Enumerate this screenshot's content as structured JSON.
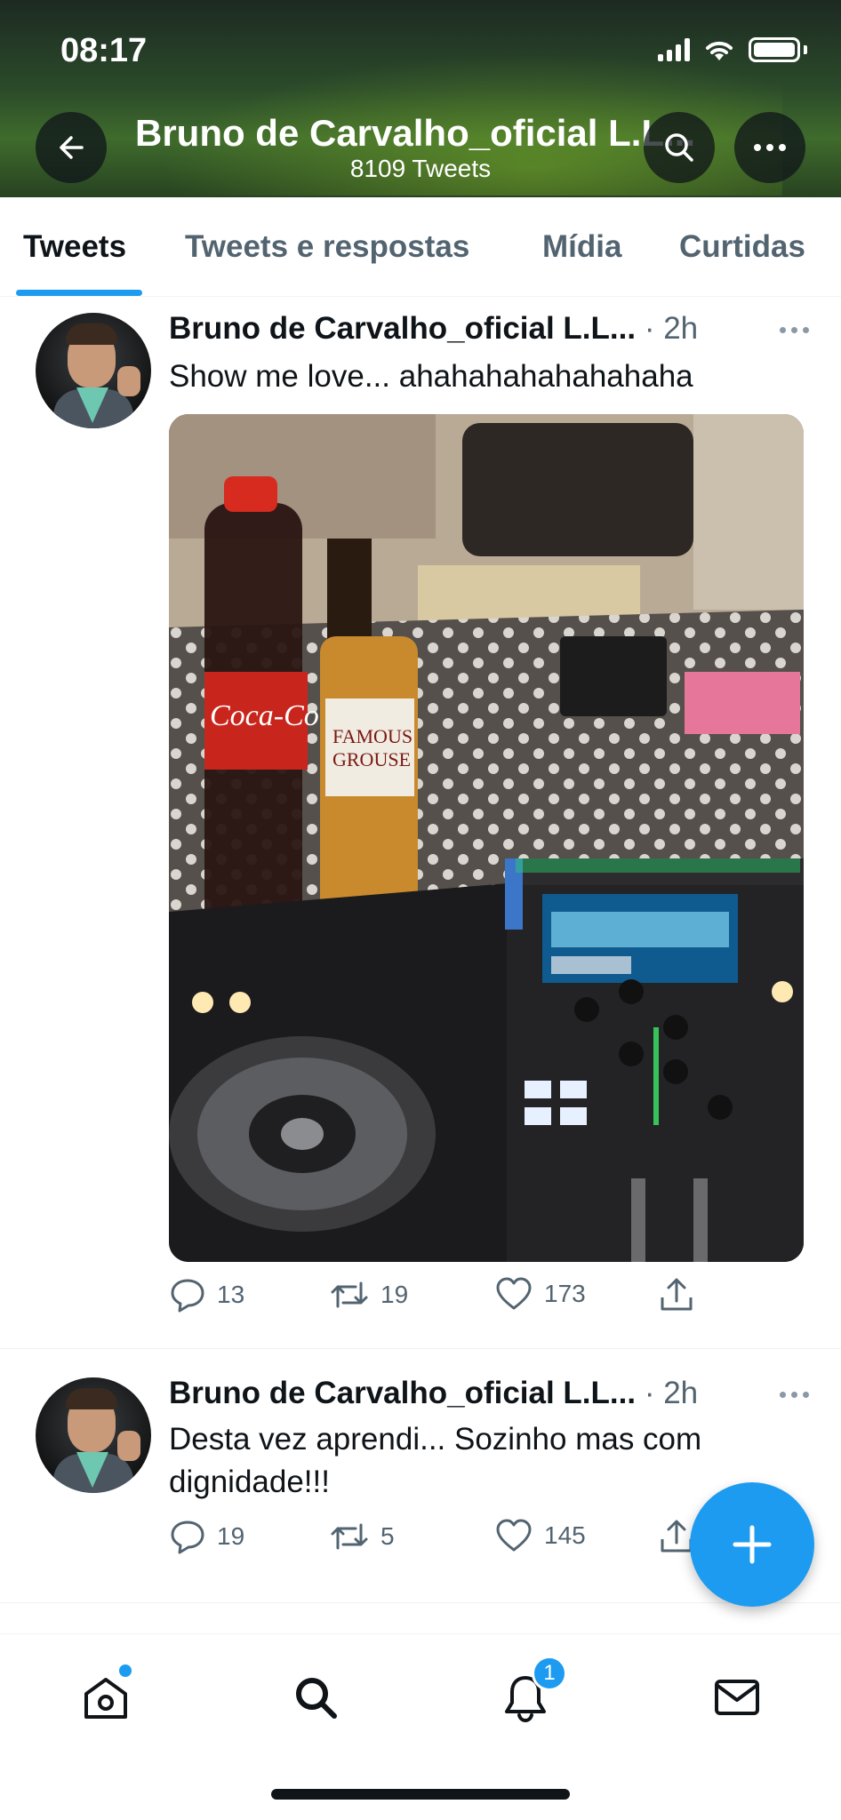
{
  "status_bar": {
    "time": "08:17"
  },
  "header": {
    "title": "Bruno de Carvalho_oficial L.L...",
    "subtitle": "8109 Tweets",
    "back_icon": "arrow-left-icon",
    "search_icon": "search-icon",
    "more_icon": "more-horizontal-icon"
  },
  "tabs": [
    {
      "label": "Tweets",
      "active": true
    },
    {
      "label": "Tweets e respostas",
      "active": false
    },
    {
      "label": "Mídia",
      "active": false
    },
    {
      "label": "Curtidas",
      "active": false
    }
  ],
  "tweets": [
    {
      "author": "Bruno de Carvalho_oficial L.L...",
      "time": "· 2h",
      "text": "Show me love... ahahahahahahahaha",
      "has_media": true,
      "replies": "13",
      "retweets": "19",
      "likes": "173"
    },
    {
      "author": "Bruno de Carvalho_oficial L.L...",
      "time": "· 2h",
      "text": "Desta vez aprendi... Sozinho mas com dignidade!!!",
      "has_media": false,
      "replies": "19",
      "retweets": "5",
      "likes": "145"
    }
  ],
  "fab": {
    "icon": "plus-icon"
  },
  "bottom_nav": {
    "items": [
      "home-icon",
      "search-icon",
      "notifications-icon",
      "messages-icon"
    ],
    "notifications_badge": "1"
  },
  "colors": {
    "accent": "#1d9bf0",
    "text": "#0f1419",
    "muted": "#536471"
  }
}
